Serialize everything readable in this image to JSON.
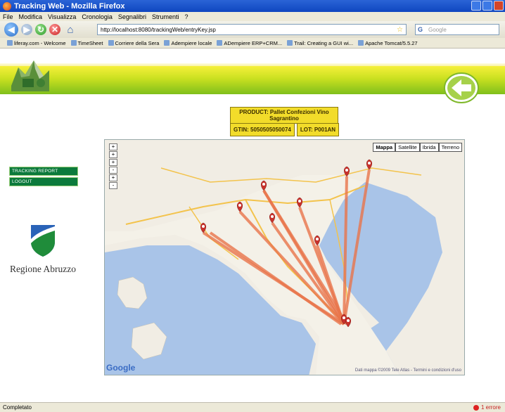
{
  "window": {
    "title": "Tracking Web - Mozilla Firefox"
  },
  "menu": [
    "File",
    "Modifica",
    "Visualizza",
    "Cronologia",
    "Segnalibri",
    "Strumenti",
    "?"
  ],
  "nav": {
    "url": "http://localhost:8080/trackingWeb/entryKey.jsp",
    "search_placeholder": "Google"
  },
  "bookmarks": [
    "liferay.com - Welcome",
    "TimeSheet",
    "Corriere della Sera",
    "Adempiere locale",
    "ADempiere ERP+CRM...",
    "Trail: Creating a GUI wi...",
    "Apache Tomcat/5.5.27"
  ],
  "product": {
    "label": "PRODUCT: Pallet Confezioni Vino Sagrantino",
    "gtin": "GTIN: 5050505050074",
    "lot": "LOT: P001AN"
  },
  "sidebar": {
    "items": [
      "TRACKING REPORT",
      "LOGOUT"
    ]
  },
  "regione": "Regione Abruzzo",
  "map": {
    "types": [
      "Mappa",
      "Satellite",
      "Ibrida",
      "Terreno"
    ],
    "active_type": "Mappa",
    "attribution": "Google",
    "copyright": "Dati mappa ©2009 Tele Atlas - Termini e condizioni d'uso",
    "zoom_controls": [
      "+",
      "+",
      "+",
      "-",
      "+",
      "-"
    ],
    "colors": {
      "route": "#e8744a",
      "marker": "#c8312b",
      "water": "#a9c4e8",
      "land": "#f1ede4"
    }
  },
  "status": {
    "left": "Completato",
    "errors": "1 errore"
  }
}
